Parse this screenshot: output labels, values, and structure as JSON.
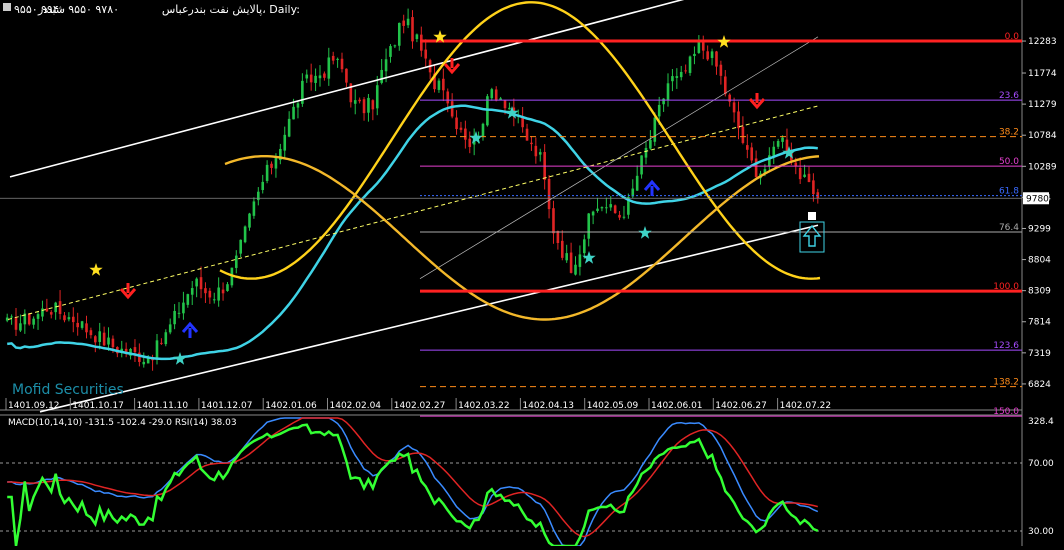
{
  "header": {
    "title": "پالایش نفت بندرعباس، Daily:",
    "ohlc": "۹۵۵۰ ۹۹۴۰ ۹۵۵۰ ۹۷۸۰",
    "subtitle": "شبندر"
  },
  "watermark": "Mofid Securities",
  "colors": {
    "background": "#000000",
    "bull": "#22c34a",
    "bear": "#e02424",
    "ma": "#3fd3e6",
    "sine": "#ffd21a",
    "channel": "#ffffff",
    "fib_main": "#ff2222",
    "fib_purple": "#a64dff",
    "fib_orange": "#ff8c1a",
    "fib_magenta": "#e640d0",
    "fib_blue": "#3a6bff",
    "fib_gray": "#aaaaaa",
    "macd_blue": "#3a8bff",
    "macd_red": "#e02424",
    "rsi_green": "#33ff33"
  },
  "price_axis": {
    "ticks": [
      "12283",
      "11774",
      "11279",
      "10784",
      "10289",
      "9794",
      "9299",
      "8804",
      "8309",
      "7814",
      "7319",
      "6824"
    ],
    "current": "9780"
  },
  "date_axis": [
    "1401.09.12",
    "1401.10.17",
    "1401.11.10",
    "1401.12.07",
    "1402.01.06",
    "1402.02.04",
    "1402.02.27",
    "1402.03.22",
    "1402.04.13",
    "1402.05.09",
    "1402.06.01",
    "1402.06.27",
    "1402.07.22"
  ],
  "fib_labels": [
    "0.0",
    "23.6",
    "38.2",
    "50.0",
    "61.8",
    "76.4",
    "100.0",
    "123.6",
    "138.2",
    "150.0"
  ],
  "indicator": {
    "label": "MACD(10,14,10) -131.5 -102.4 -29.0 RSI(14) 38.03",
    "ticks": [
      "328.4",
      "70.00",
      "30.00"
    ]
  },
  "chart_data": {
    "type": "candlestick",
    "title": "پالایش نفت بندرعباس، Daily:",
    "series": [
      {
        "name": "price",
        "values": [
          7780,
          7800,
          7850,
          7920,
          8050,
          8000,
          7900,
          7850,
          7700,
          7600,
          7500,
          7400,
          7350,
          7300,
          7250,
          7350,
          7600,
          7900,
          8200,
          8450,
          8300,
          8250,
          8400,
          8700,
          9200,
          9700,
          10100,
          10400,
          10800,
          11200,
          11600,
          11700,
          11800,
          12000,
          11800,
          11300,
          11200,
          11300,
          11850,
          12200,
          12650,
          12400,
          12100,
          11600,
          11700,
          11100,
          10900,
          10600,
          11000,
          11500,
          11400,
          11200,
          10900,
          10600,
          10400,
          9400,
          9000,
          8700,
          9000,
          9500,
          9700,
          9600,
          9500,
          9750,
          10300,
          10700,
          11200,
          11700,
          11650,
          11900,
          12200,
          12100,
          11800,
          11300,
          10900,
          10400,
          10200,
          10300,
          10800,
          10600,
          10200,
          9950,
          9780
        ]
      }
    ],
    "ylim": [
      6600,
      12650
    ],
    "fib_levels": [
      {
        "label": "0.0",
        "price": 12283
      },
      {
        "label": "23.6",
        "price": 11343
      },
      {
        "label": "38.2",
        "price": 10762
      },
      {
        "label": "50.0",
        "price": 10292
      },
      {
        "label": "61.8",
        "price": 9823
      },
      {
        "label": "76.4",
        "price": 9242
      },
      {
        "label": "100.0",
        "price": 8302
      },
      {
        "label": "123.6",
        "price": 7362
      },
      {
        "label": "138.2",
        "price": 6781
      },
      {
        "label": "150.0",
        "price": 6312
      }
    ],
    "grid": false,
    "indicator": {
      "macd_ylim": [
        -250,
        328.4
      ],
      "rsi_levels": [
        70,
        30
      ],
      "macd_value": -131.5,
      "signal_value": -102.4,
      "histogram_value": -29.0,
      "rsi_value": 38.03
    }
  }
}
